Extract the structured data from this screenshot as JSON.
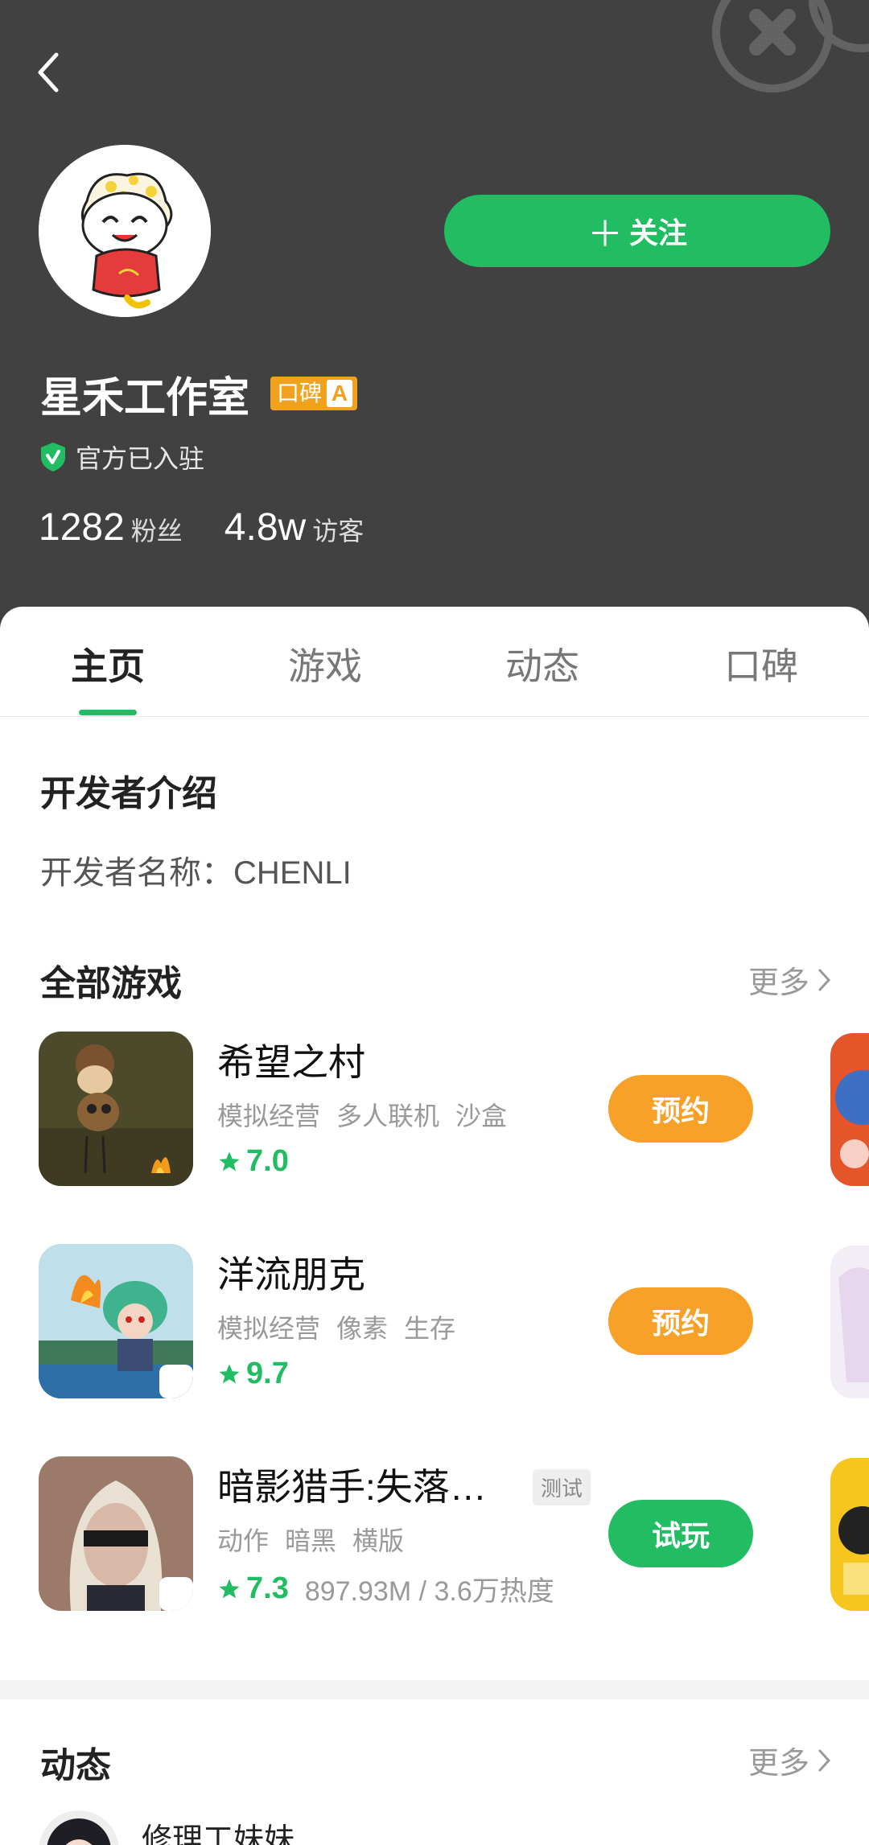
{
  "header": {
    "studio_name": "星禾工作室",
    "reputation_badge_text": "口碑",
    "reputation_grade": "A",
    "official_text": "官方已入驻",
    "follow_label": "关注",
    "stats": [
      {
        "value": "1282",
        "label": "粉丝"
      },
      {
        "value": "4.8w",
        "label": "访客"
      }
    ]
  },
  "tabs": [
    "主页",
    "游戏",
    "动态",
    "口碑"
  ],
  "active_tab": "主页",
  "developer": {
    "section_title": "开发者介绍",
    "name_line": "开发者名称：CHENLI"
  },
  "games_section": {
    "title": "全部游戏",
    "more": "更多",
    "games": [
      {
        "name": "希望之村",
        "tags": [
          "模拟经营",
          "多人联机",
          "沙盒"
        ],
        "rating": "7.0",
        "meta": "",
        "badge": "",
        "action": "预约"
      },
      {
        "name": "洋流朋克",
        "tags": [
          "模拟经营",
          "像素",
          "生存"
        ],
        "rating": "9.7",
        "meta": "",
        "badge": "",
        "action": "预约"
      },
      {
        "name": "暗影猎手:失落…",
        "tags": [
          "动作",
          "暗黑",
          "横版"
        ],
        "rating": "7.3",
        "meta": "897.93M / 3.6万热度",
        "badge": "测试",
        "action": "试玩"
      }
    ]
  },
  "feed_section": {
    "title": "动态",
    "more": "更多",
    "first_author": "修理工妹妹"
  },
  "colors": {
    "accent_green": "#22bd63",
    "accent_orange": "#f7a128",
    "header_bg": "#414141"
  }
}
